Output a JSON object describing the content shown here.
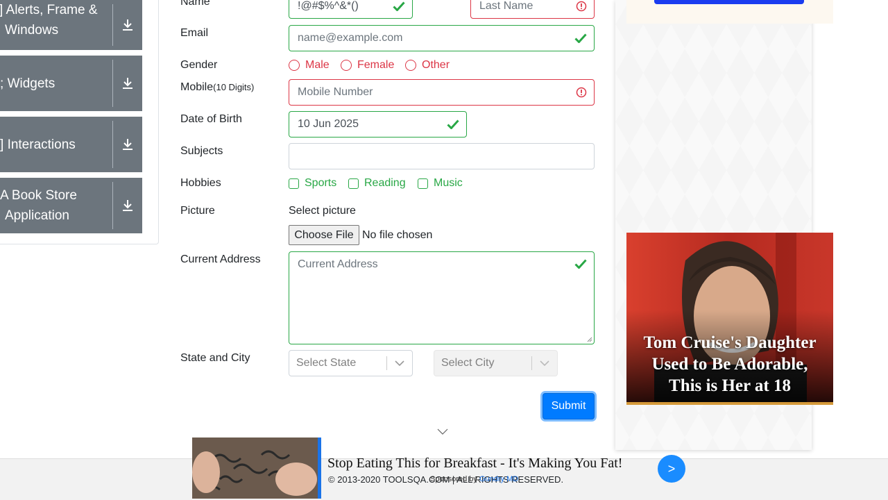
{
  "sidebar": {
    "groups": [
      {
        "label": "Alerts, Frame &",
        "label2": "Windows"
      },
      {
        "label": "Widgets"
      },
      {
        "label": "Interactions"
      },
      {
        "label": "Book Store",
        "label2": "Application"
      }
    ]
  },
  "form": {
    "name_label": "Name",
    "first_name_value": "!@#$%^&*()",
    "last_name_placeholder": "Last Name",
    "email_label": "Email",
    "email_placeholder": "name@example.com",
    "gender_label": "Gender",
    "gender_options": [
      "Male",
      "Female",
      "Other"
    ],
    "mobile_label": "Mobile",
    "mobile_hint": "(10 Digits)",
    "mobile_placeholder": "Mobile Number",
    "dob_label": "Date of Birth",
    "dob_value": "10 Jun 2025",
    "subjects_label": "Subjects",
    "hobbies_label": "Hobbies",
    "hobbies_options": [
      "Sports",
      "Reading",
      "Music"
    ],
    "picture_label": "Picture",
    "select_picture_label": "Select picture",
    "choose_file_label": "Choose File",
    "no_file_text": "No file chosen",
    "address_label": "Current Address",
    "address_placeholder": "Current Address",
    "state_city_label": "State and City",
    "state_placeholder": "Select State",
    "city_placeholder": "Select City",
    "submit_label": "Submit"
  },
  "ads": {
    "photo_caption": "Tom Cruise's Daughter Used to Be Adorable, This is Her at 18",
    "bottom_headline": "Stop Eating This for Breakfast - It's Making You Fat!",
    "go_label": ">",
    "sponsored_prefix": "Sponsored by",
    "sponsored_name": "Gundry MD"
  },
  "footer": {
    "copyright": "© 2013-2020 TOOLSQA.COM | ALL RIGHTS RESERVED."
  },
  "colors": {
    "valid": "#28a745",
    "invalid": "#dc3545",
    "primary": "#007bff",
    "sidebar_group": "#6c757d"
  },
  "icons": [
    "download-icon",
    "check-icon",
    "error-icon",
    "chevron-down-icon"
  ]
}
